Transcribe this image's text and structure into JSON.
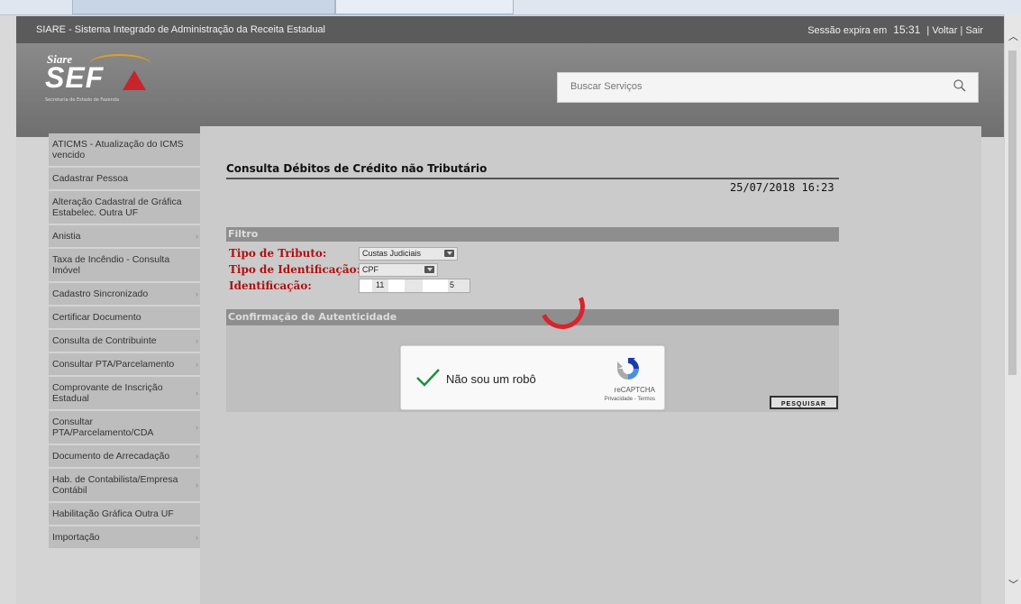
{
  "topbar": {
    "title": "SIARE - Sistema Integrado de Administração da Receita Estadual",
    "session_label": "Sessão expira em",
    "session_time": "15:31",
    "back_link": "Voltar",
    "exit_link": "Sair",
    "separator": "|"
  },
  "logo": {
    "siare": "Siare",
    "sef": "SEF",
    "subtitle": "Secretaria de Estado de Fazenda"
  },
  "search": {
    "placeholder": "Buscar Serviços"
  },
  "sidebar": {
    "items": [
      {
        "label": "ATICMS - Atualização do ICMS vencido",
        "arrow": ""
      },
      {
        "label": "Cadastrar Pessoa",
        "arrow": ""
      },
      {
        "label": "Alteração Cadastral de Gráfica Estabelec. Outra UF",
        "arrow": ""
      },
      {
        "label": "Anistia",
        "arrow": "›"
      },
      {
        "label": "Taxa de Incêndio - Consulta Imóvel",
        "arrow": ""
      },
      {
        "label": "Cadastro Sincronizado",
        "arrow": "›"
      },
      {
        "label": "Certificar Documento",
        "arrow": ""
      },
      {
        "label": "Consulta de Contribuinte",
        "arrow": "›"
      },
      {
        "label": "Consultar PTA/Parcelamento",
        "arrow": "›"
      },
      {
        "label": "Comprovante de Inscrição Estadual",
        "arrow": "›"
      },
      {
        "label": "Consultar PTA/Parcelamento/CDA",
        "arrow": "›"
      },
      {
        "label": "Documento de Arrecadação",
        "arrow": "›"
      },
      {
        "label": "Hab. de Contabilista/Empresa Contábil",
        "arrow": "›"
      },
      {
        "label": "Habilitação Gráfica Outra UF",
        "arrow": ""
      },
      {
        "label": "Importação",
        "arrow": "›"
      }
    ]
  },
  "main": {
    "heading": "Consulta Débitos de Crédito não Tributário",
    "datetime": "25/07/2018 16:23",
    "filter_title": "Filtro",
    "tipo_tributo_label": "Tipo de Tributo:",
    "tipo_tributo_value": "Custas Judiciais",
    "tipo_ident_label": "Tipo de Identificação:",
    "tipo_ident_value": "CPF",
    "ident_label": "Identificação:",
    "ident_value_a": "11",
    "ident_value_b": "5",
    "auth_title": "Confirmação de Autenticidade",
    "recaptcha_label": "Não sou um robô",
    "recaptcha_brand": "reCAPTCHA",
    "recaptcha_links": "Privacidade - Termos",
    "search_button": "PESQUISAR"
  },
  "colors": {
    "accent_red": "#b01010",
    "spinner": "#d9232d",
    "check_green": "#1e8f3c"
  }
}
